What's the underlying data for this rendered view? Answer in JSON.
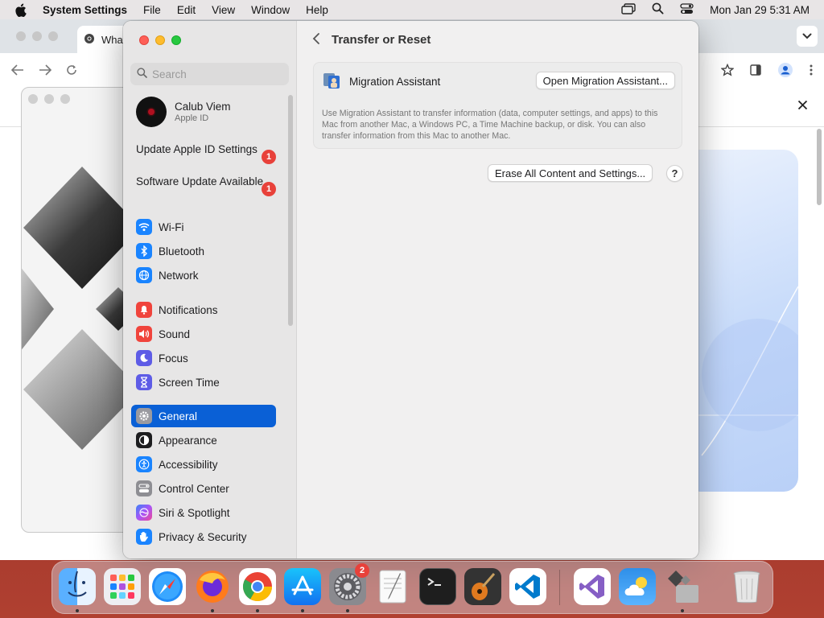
{
  "menubar": {
    "app_name": "System Settings",
    "items": [
      "File",
      "Edit",
      "View",
      "Window",
      "Help"
    ],
    "clock": "Mon Jan 29  5:31 AM"
  },
  "chrome": {
    "tab_title": "What"
  },
  "sidebar": {
    "search_placeholder": "Search",
    "profile": {
      "name": "Calub Viem",
      "subtitle": "Apple ID"
    },
    "notices": [
      {
        "label": "Update Apple ID Settings",
        "badge": "1"
      },
      {
        "label": "Software Update Available",
        "badge": "1"
      }
    ],
    "groups": [
      [
        {
          "label": "Wi-Fi",
          "icon": "wifi-icon",
          "color": "#1a84ff"
        },
        {
          "label": "Bluetooth",
          "icon": "bluetooth-icon",
          "color": "#1a84ff"
        },
        {
          "label": "Network",
          "icon": "globe-icon",
          "color": "#1a84ff"
        }
      ],
      [
        {
          "label": "Notifications",
          "icon": "bell-icon",
          "color": "#f0443c"
        },
        {
          "label": "Sound",
          "icon": "speaker-icon",
          "color": "#f0443c"
        },
        {
          "label": "Focus",
          "icon": "moon-icon",
          "color": "#5e5ce6"
        },
        {
          "label": "Screen Time",
          "icon": "hourglass-icon",
          "color": "#5e5ce6"
        }
      ],
      [
        {
          "label": "General",
          "icon": "gear-icon",
          "color": "#8e8e93",
          "selected": true
        },
        {
          "label": "Appearance",
          "icon": "appearance-icon",
          "color": "#1d1d1f"
        },
        {
          "label": "Accessibility",
          "icon": "accessibility-icon",
          "color": "#1a84ff"
        },
        {
          "label": "Control Center",
          "icon": "control-center-icon",
          "color": "#8e8e93"
        },
        {
          "label": "Siri & Spotlight",
          "icon": "siri-icon",
          "color": "#9d4edd"
        },
        {
          "label": "Privacy & Security",
          "icon": "hand-icon",
          "color": "#1a84ff"
        }
      ]
    ]
  },
  "main": {
    "title": "Transfer or Reset",
    "migration": {
      "label": "Migration Assistant",
      "button": "Open Migration Assistant...",
      "description": "Use Migration Assistant to transfer information (data, computer settings, and apps) to this Mac from another Mac, a Windows PC, a Time Machine backup, or disk. You can also transfer information from this Mac to another Mac."
    },
    "erase_button": "Erase All Content and Settings...",
    "help_button": "?"
  },
  "dock": {
    "apps": [
      "Finder",
      "Launchpad",
      "Safari",
      "Firefox",
      "Chrome",
      "App Store",
      "System Settings",
      "TextEdit",
      "Terminal",
      "GarageBand",
      "VS Code",
      "Visual Studio",
      "Weather",
      "Boot Camp Assistant",
      "Trash"
    ],
    "settings_badge": "2"
  }
}
